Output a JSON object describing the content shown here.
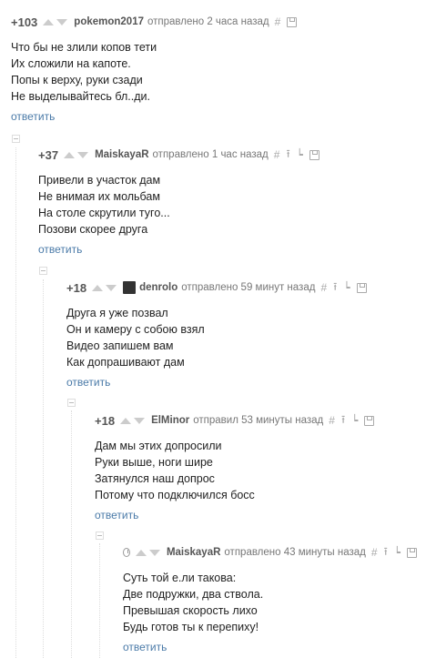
{
  "comments": [
    {
      "rating": "+103",
      "author": "pokemon2017",
      "meta": "отправлено 2 часа назад",
      "lines": [
        "Что бы не злили копов тети",
        "Их сложили на капоте.",
        "Попы к верху, руки сзади",
        "Не выделывайтесь бл..ди."
      ],
      "reply": "ответить"
    },
    {
      "rating": "+37",
      "author": "MaiskayaR",
      "meta": "отправлено 1 час назад",
      "lines": [
        "Привели в участок дам",
        "Не внимая их мольбам",
        "На столе скрутили туго...",
        "Позови скорее друга"
      ],
      "reply": "ответить"
    },
    {
      "rating": "+18",
      "author": "denrolo",
      "meta": "отправлено 59 минут назад",
      "lines": [
        "Друга я уже позвал",
        "Он и камеру с собою взял",
        "Видео запишем вам",
        "Как допрашивают дам"
      ],
      "reply": "ответить"
    },
    {
      "rating": "+18",
      "author": "ElMinor",
      "meta": "отправил 53 минуты назад",
      "lines": [
        "Дам мы этих допросили",
        "Руки выше, ноги шире",
        "Затянулся наш допрос",
        "Потому что подключился босс"
      ],
      "reply": "ответить"
    },
    {
      "rating": "",
      "author": "MaiskayaR",
      "meta": "отправлено 43 минуты назад",
      "lines": [
        "Суть той е.ли такова:",
        "Две подружки, два ствола.",
        "Превышая скорость лихо",
        "Будь готов ты к перепиху!"
      ],
      "reply": "ответить"
    }
  ],
  "icons": {
    "hash": "#",
    "parent": "⭱",
    "thread": "┕",
    "save": "save-icon"
  }
}
